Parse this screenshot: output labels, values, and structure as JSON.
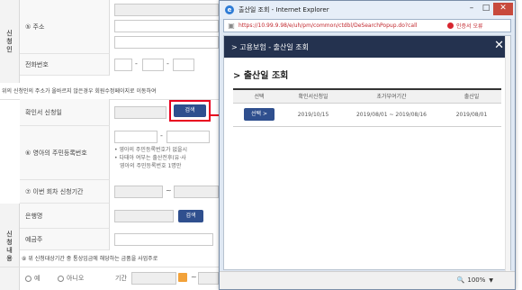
{
  "form": {
    "side_applicant": "신청인",
    "side_content": "신청내용",
    "address_label": "⑤ 주소",
    "phone_label": "전화번호",
    "address_notice": "위의 신청인의 주소가 올바르지 않은경우 회원수정페이지로 이동하여",
    "confirm_date_label": "확인서 신청일",
    "search_btn": "검색",
    "infant_id_label": "⑥ 영아의 주민등록번호",
    "infant_notes": [
      "• 영아의 주민등록번호가 없을시",
      "• 다태아 여부는 출산전후(유·사",
      "영아의 주민등록번호 1명만"
    ],
    "prev_period_label": "⑦ 이번 회차 신청기간",
    "bank_label": "은행명",
    "bank_search_btn": "검색",
    "holder_label": "예금주",
    "wage_question": "⑧ 위 신청대상기간 중 통상임금에 해당하는 금품을 사업주로",
    "radio_yes": "예",
    "radio_no": "아니오",
    "period_label": "기간"
  },
  "popup": {
    "window_title": "출산일 조회 - Internet Explorer",
    "url": "https://10.99.9.98/e/uh/pm/common/ctdbl/DeSearchPopup.do?call",
    "cert_text": "인증서 오류",
    "breadcrumb": "> 고용보험 - 출산일 조회",
    "section_title": "> 출산일 조회",
    "table": {
      "headers": [
        "선택",
        "확인서신청일",
        "초가부여기간",
        "출산일"
      ],
      "rows": [
        {
          "select": "선택 >",
          "apply_date": "2019/10/15",
          "period": "2019/08/01 ~ 2019/08/16",
          "birth_date": "2019/08/01"
        }
      ]
    },
    "zoom": "100%"
  },
  "colors": {
    "navy": "#24324f",
    "button_blue": "#2f4f8e",
    "callout_red": "#e8001e"
  }
}
